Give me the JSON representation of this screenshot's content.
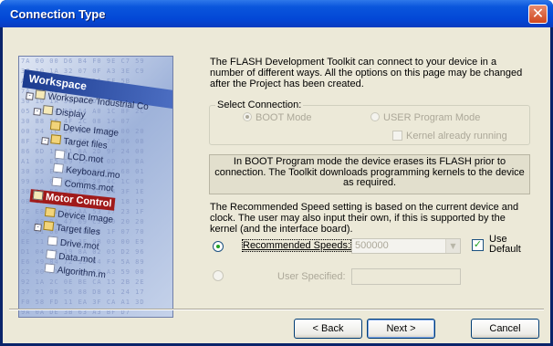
{
  "window": {
    "title": "Connection Type",
    "close_glyph": "✕"
  },
  "splash": {
    "header": "Workspace",
    "hex_lines": [
      "7A 00 00 D6 B4 F0 9E C7 59",
      "30 10 1A 32 07 0F A3 3E C9",
      "A4 6F FB 93 5D DA FF 5B",
      "7A 06 00 D6 8C 5D 19 4E 8F",
      "30 10 1A 32 07 DF A3 3E C9",
      "05 00 24 80 64 A0 1C 8F 2C",
      "30 88 56 4F 2C 08 14 07",
      "00 D4 1C 38 B9 7E 0E 00 20",
      "8F 22 64 E3 79 11 70 06 0B",
      "86 6D 1D 31 8A 2D 9F 24 00",
      "A1 00 E5 E9 72 AF 0D A0 BA",
      "30 D5 EC 49 86 E9 BC 68 01",
      "99 6A 0D 00 FF 20 4C 1C 00",
      "30 6D F9 5E C8 59 B4 3F 1E",
      "0B 0A 08 00 CB 64 95 18 19",
      "7E E8 B1 1C AA 53 17 23 1F",
      "76 08 0A 47 69 C5 80 20 20",
      "0C 61 00 4A 8B E8 1F 07 70",
      "EE 11 A2 23 3F 0B 03 00 E9",
      "D1 04 F6 19 8A 02 05 D2 96",
      "E6 49 84 72 15 84 F4 5A 89",
      "C2 00 A1 7E 0E C9 A3 59 00",
      "92 1A 2C 0E BE CA 15 2B 2E",
      "37 91 08 56 88 D8 61 24 17",
      "F0 58 FD 11 EA 3F CA A1 3D",
      "9A 0A DE 3B 63 A3 BF D7",
      "04 04 4D 75 54 30 AB 7E 11",
      "AF EE 04 8C 53 2E 48 0C",
      "0B 59 18 A3 C7 0E 02 D6 44",
      "00 4F 0C 17 EB 83 28 06 14"
    ],
    "tree": {
      "workspace": "Workspace 'Industrial Co",
      "display": "Display",
      "device_image_1": "Device Image",
      "target_files_1": "Target files",
      "lcd": "LCD.mot",
      "keyboard": "Keyboard.mo",
      "comms": "Comms.mot",
      "motor_control": "Motor Control",
      "device_image_2": "Device Image",
      "target_files_2": "Target files",
      "drive": "Drive.mot",
      "data": "Data.mot",
      "algorithm": "Algorithm.m"
    }
  },
  "intro_text": "The FLASH Development Toolkit can connect to your device in a number of different ways. All the options on this page may be changed after the Project has been created.",
  "select_connection": {
    "legend": "Select Connection:",
    "boot_mode": "BOOT Mode",
    "user_program_mode": "USER Program Mode",
    "kernel_running": "Kernel already running"
  },
  "info_text": "In BOOT Program mode the device erases its FLASH prior to connection. The Toolkit downloads programming kernels to the device as required.",
  "speed_text": "The Recommended Speed setting is based on the current device and clock. The user may also input their own, if this is supported by the kernel (and the interface board).",
  "speeds": {
    "recommended_label": "Recommended Speeds:",
    "recommended_value": "500000",
    "dropdown_glyph": "▼",
    "use_default_label": "Use Default",
    "use_default_check": "✓",
    "user_specified_label": "User Specified:",
    "user_specified_value": ""
  },
  "buttons": {
    "back": "< Back",
    "next": "Next >",
    "cancel": "Cancel"
  },
  "colors": {
    "title_bar": "#0a56dc",
    "dialog_bg": "#ece9d8",
    "close_button": "#d0471e",
    "highlight": "#a01a1a"
  }
}
